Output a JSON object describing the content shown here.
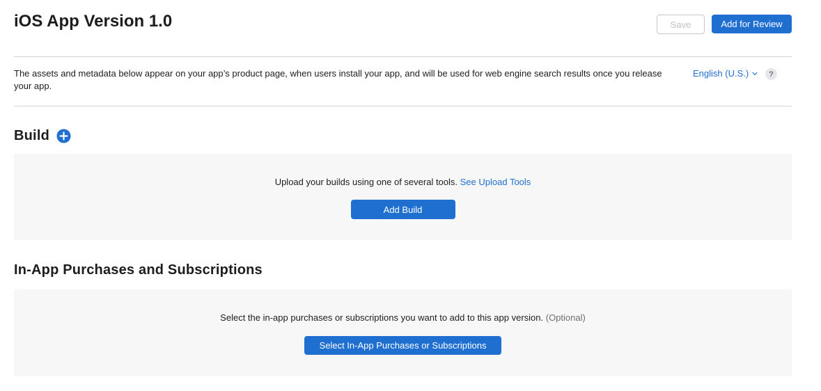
{
  "header": {
    "title": "iOS App Version 1.0",
    "save_label": "Save",
    "review_label": "Add for Review"
  },
  "info": {
    "description": "The assets and metadata below appear on your app’s product page, when users install your app, and will be used for web engine search results once you release your app.",
    "language": "English (U.S.)",
    "help_glyph": "?"
  },
  "build": {
    "title": "Build",
    "upload_text": "Upload your builds using one of several tools.",
    "upload_link": "See Upload Tools",
    "button_label": "Add Build"
  },
  "iap": {
    "title": "In-App Purchases and Subscriptions",
    "select_text": "Select the in-app purchases or subscriptions you want to add to this app version.",
    "optional_label": "(Optional)",
    "button_label": "Select In-App Purchases or Subscriptions"
  },
  "colors": {
    "accent": "#1f6fd1",
    "panel_background": "#f7f7f7",
    "divider": "#d2d2d7"
  },
  "icons": {
    "add_build": "plus-circle-icon",
    "language_dropdown": "chevron-down-icon",
    "help": "question-mark-icon"
  }
}
